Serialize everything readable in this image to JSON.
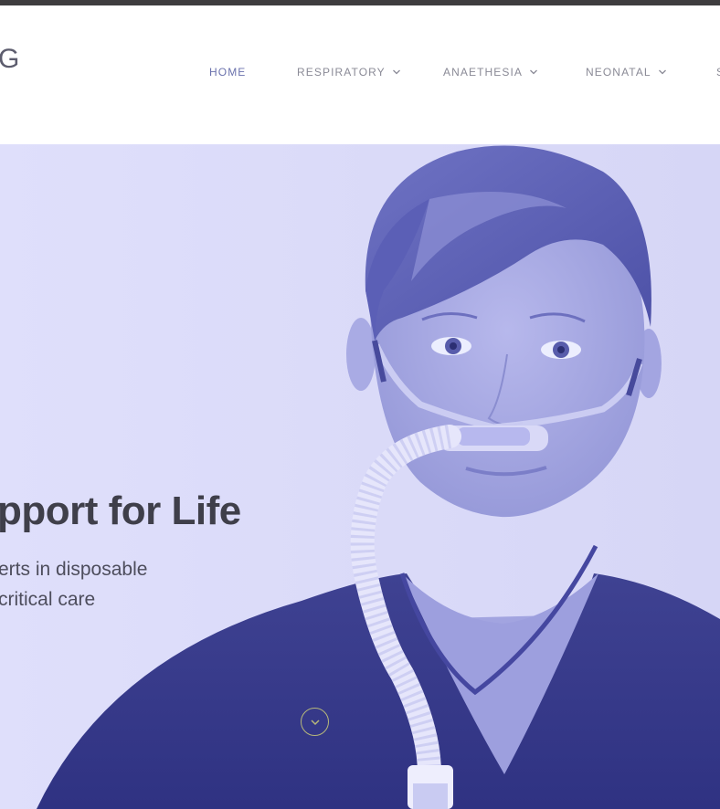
{
  "header": {
    "logo_text": "G",
    "nav": [
      {
        "label": "HOME",
        "active": true,
        "has_dropdown": false
      },
      {
        "label": "RESPIRATORY",
        "active": false,
        "has_dropdown": true
      },
      {
        "label": "ANAETHESIA",
        "active": false,
        "has_dropdown": true
      },
      {
        "label": "NEONATAL",
        "active": false,
        "has_dropdown": true
      },
      {
        "label": "S",
        "active": false,
        "has_dropdown": false
      }
    ]
  },
  "hero": {
    "headline": "pport for Life",
    "subline_1": "erts in disposable",
    "subline_2": "critical care",
    "scroll_icon": "chevron-down-circle-icon",
    "tint_color": "#5a5fb3",
    "background_color": "#dcdcf9"
  },
  "colors": {
    "topbar": "#3e3d3f",
    "nav_active": "#6b72ad",
    "nav_text": "#8a8a96",
    "headline": "#3f3f4a"
  }
}
